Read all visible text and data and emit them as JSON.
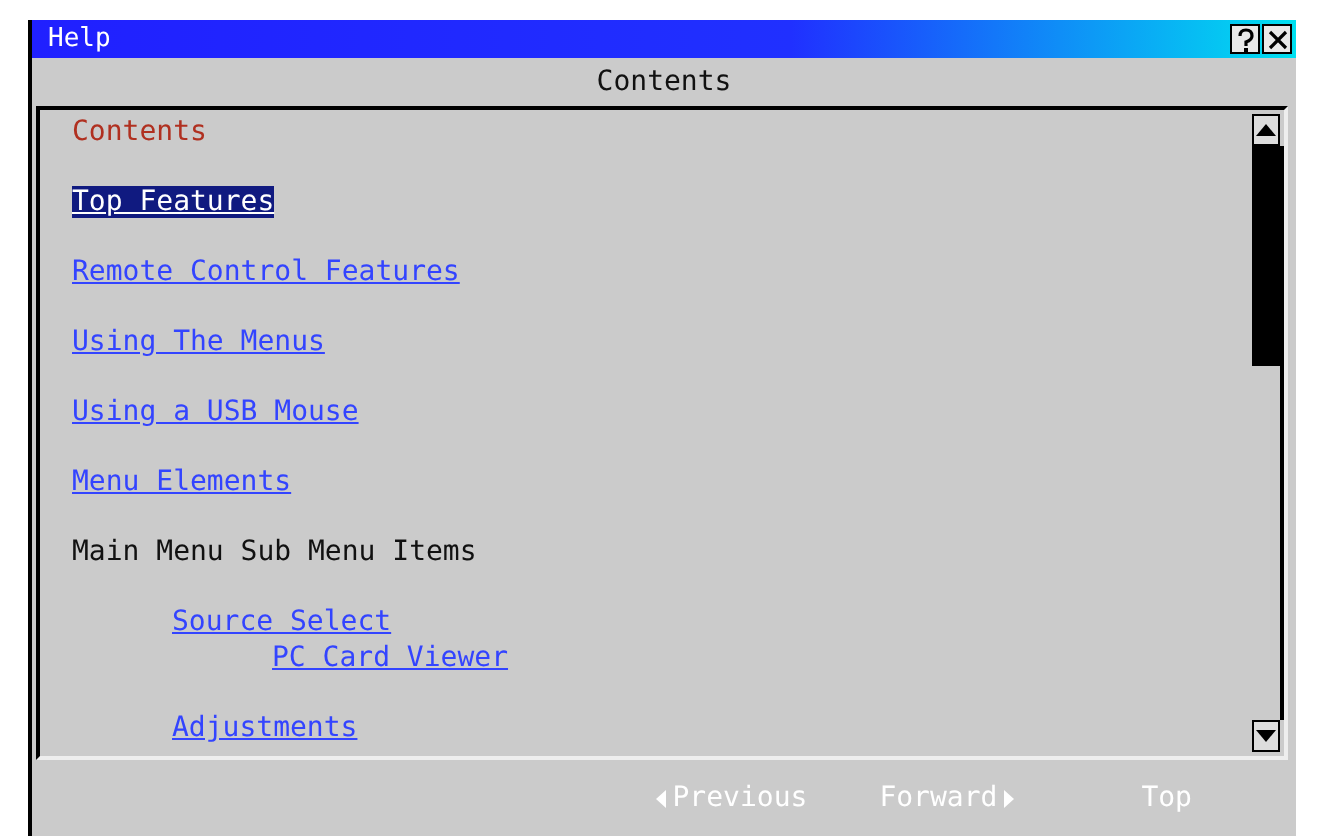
{
  "window": {
    "title": "Help"
  },
  "heading": "Contents",
  "items": [
    {
      "kind": "title",
      "label": "Contents"
    },
    {
      "kind": "link",
      "label": "Top Features",
      "selected": true
    },
    {
      "kind": "link",
      "label": "Remote Control Features",
      "selected": false
    },
    {
      "kind": "link",
      "label": "Using The Menus",
      "selected": false
    },
    {
      "kind": "link",
      "label": "Using a USB Mouse",
      "selected": false
    },
    {
      "kind": "link",
      "label": "Menu Elements",
      "selected": false
    },
    {
      "kind": "text",
      "label": "Main Menu Sub Menu Items",
      "children": [
        {
          "kind": "link",
          "label": "Source Select",
          "selected": false,
          "children": [
            {
              "kind": "link",
              "label": "PC Card Viewer",
              "selected": false
            }
          ]
        },
        {
          "kind": "link",
          "label": "Adjustments",
          "selected": false
        }
      ]
    }
  ],
  "nav": [
    {
      "kind": "previous",
      "label": "Previous"
    },
    {
      "kind": "forward",
      "label": "Forward"
    },
    {
      "kind": "top",
      "label": "Top"
    }
  ]
}
